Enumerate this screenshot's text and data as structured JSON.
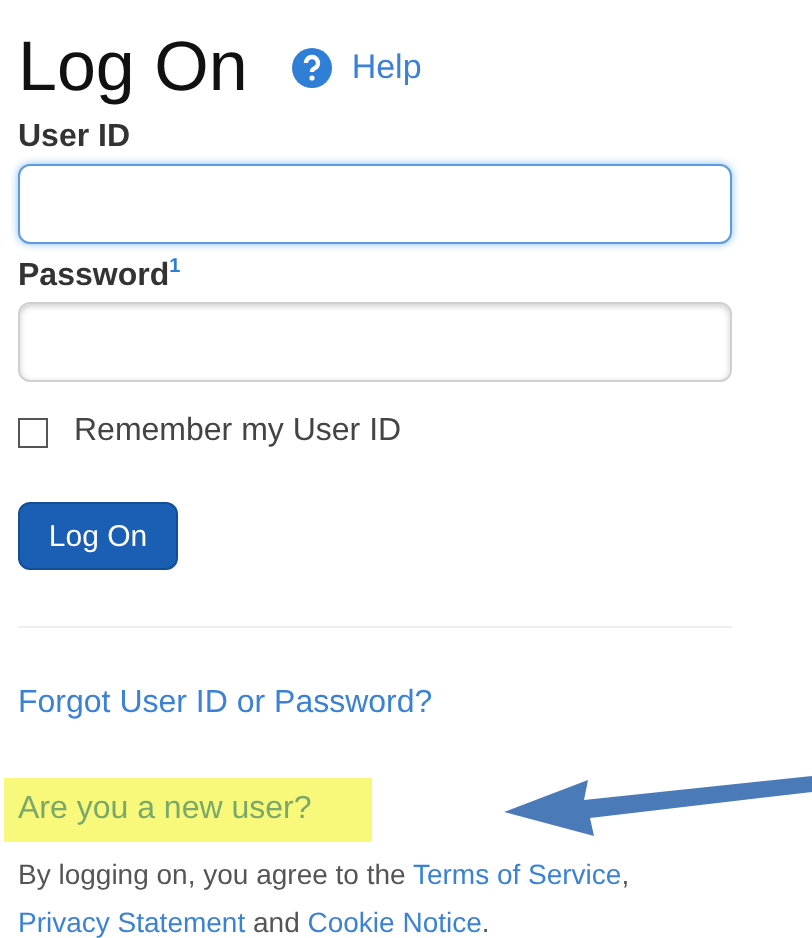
{
  "title": "Log On",
  "help": {
    "label": "Help"
  },
  "fields": [
    {
      "label": "User ID",
      "focused": true
    },
    {
      "label": "Password",
      "footnote": "1",
      "focused": false
    }
  ],
  "remember": {
    "label": "Remember my User ID",
    "checked": false
  },
  "submit": {
    "label": "Log On"
  },
  "forgot": {
    "label": "Forgot User ID or Password?"
  },
  "new_user": {
    "label": "Are you a new user?",
    "highlighted": true
  },
  "legal": [
    {
      "kind": "text",
      "text": "By logging on, you agree to the "
    },
    {
      "kind": "link",
      "text": "Terms of Service"
    },
    {
      "kind": "text",
      "text": ", "
    },
    {
      "kind": "link",
      "text": "Privacy Statement"
    },
    {
      "kind": "text",
      "text": " and "
    },
    {
      "kind": "link",
      "text": "Cookie Notice"
    },
    {
      "kind": "text",
      "text": "."
    }
  ]
}
